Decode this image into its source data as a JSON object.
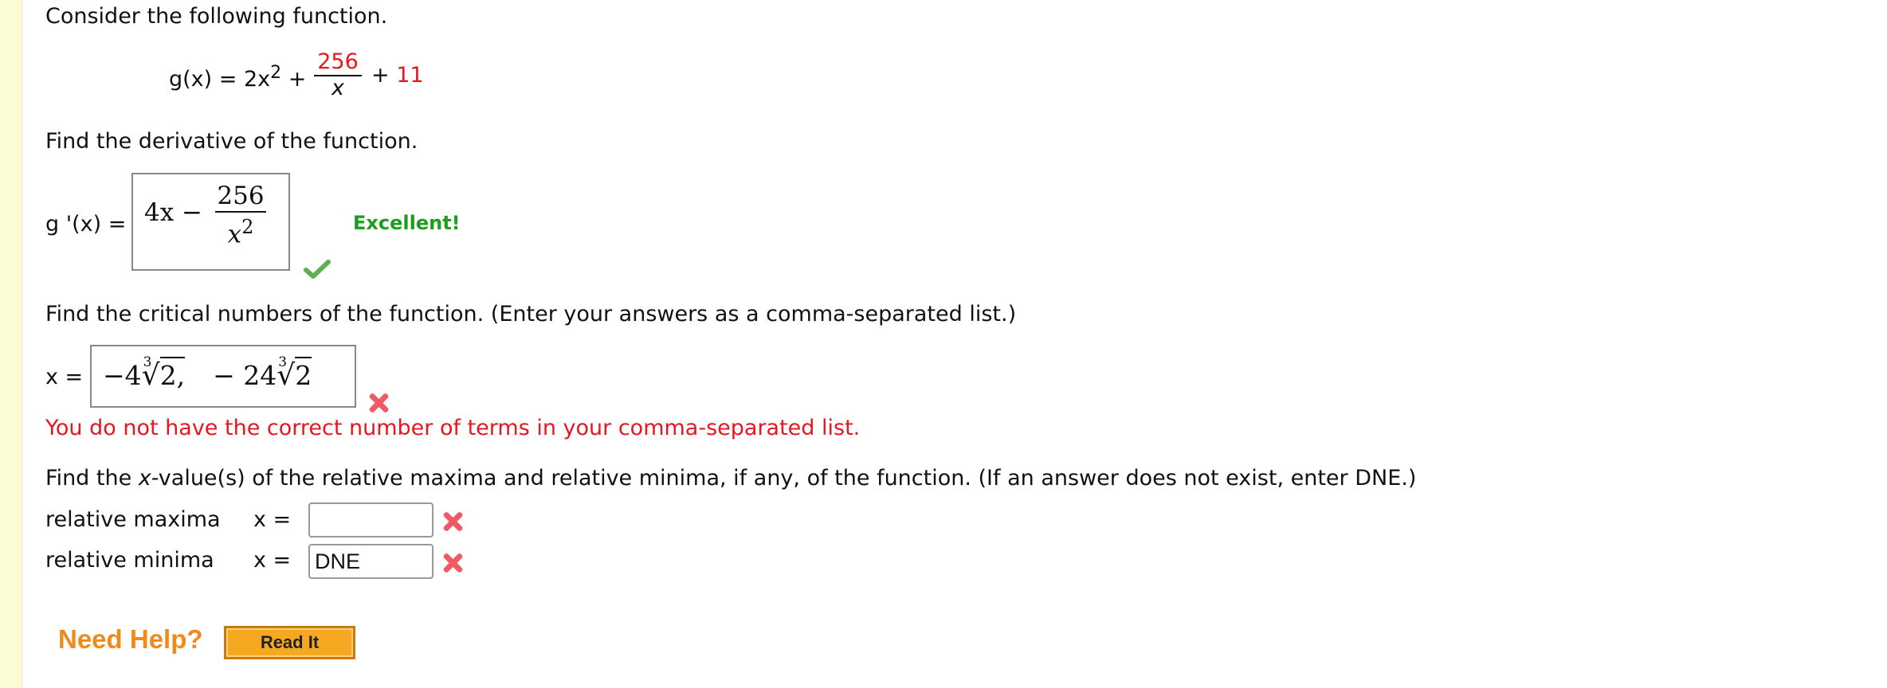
{
  "intro": "Consider the following function.",
  "function_def": {
    "lhs": "g(x) = 2x",
    "exp": "2",
    "plus1": "+",
    "numerator": "256",
    "denominator": "x",
    "tail_plus": "+",
    "constant": "11"
  },
  "q1": {
    "prompt": "Find the derivative of the function.",
    "label": "g '(x) =",
    "answer_first": "4x −",
    "answer_numerator": "256",
    "answer_den_base": "x",
    "answer_den_exp": "2",
    "feedback": "Excellent!",
    "status": "correct"
  },
  "q2": {
    "prompt": "Find the critical numbers of the function. (Enter your answers as a comma-separated list.)",
    "label": "x =",
    "answer_part1_coef": "−4",
    "answer_part1_index": "3",
    "answer_part1_radicand": "2,",
    "answer_part2_coef": "− 24",
    "answer_part2_index": "3",
    "answer_part2_radicand": "2",
    "feedback": "You do not have the correct number of terms in your comma-separated list.",
    "status": "incorrect"
  },
  "q3": {
    "prompt_start": "Find the ",
    "prompt_var": "x",
    "prompt_end": "-value(s) of the relative maxima and relative minima, if any, of the function. (If an answer does not exist, enter DNE.)",
    "rel_max_label": "relative maxima",
    "rel_max_eq": "x =",
    "rel_max_value": "",
    "rel_max_status": "incorrect",
    "rel_min_label": "relative minima",
    "rel_min_eq": "x =",
    "rel_min_value": "DNE",
    "rel_min_status": "incorrect"
  },
  "help": {
    "label": "Need Help?",
    "read_it": "Read It"
  },
  "colors": {
    "sidebar": "#fbfbd6",
    "error": "#e8161e",
    "success": "#1e9e1e",
    "help": "#f08a1c",
    "read_it_button": "#f7a823"
  }
}
